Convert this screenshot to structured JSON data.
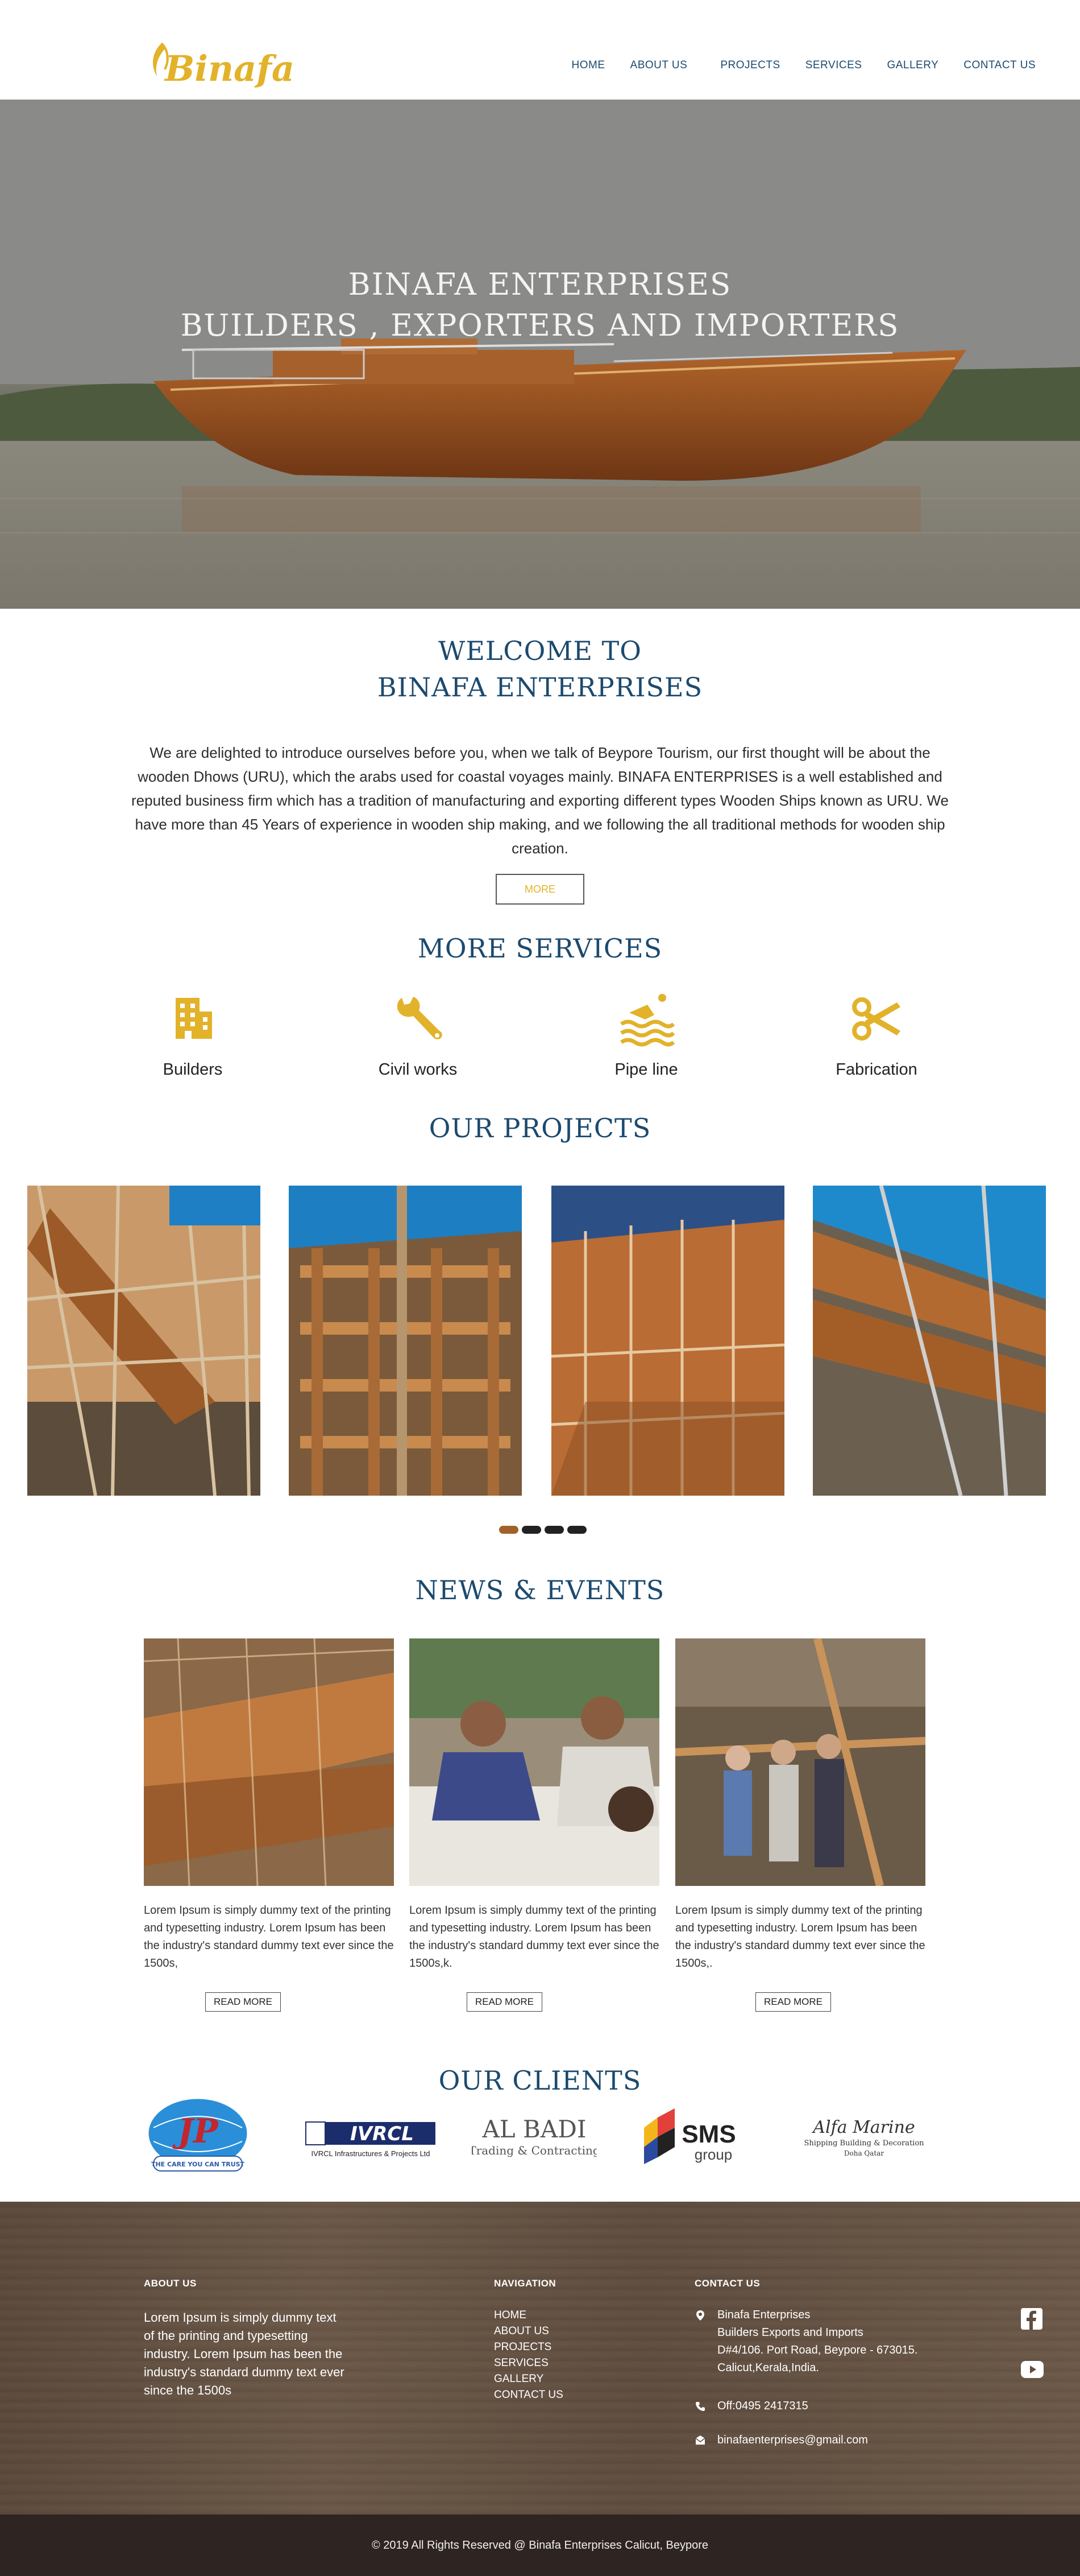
{
  "brand": {
    "logo_text": "Binafa",
    "accent_color": "#e2b22a",
    "heading_color": "#1c4a6e"
  },
  "nav": {
    "items": [
      "HOME",
      "ABOUT US",
      "PROJECTS",
      "SERVICES",
      "GALLERY",
      "CONTACT US"
    ]
  },
  "hero": {
    "line1": "BINAFA ENTERPRISES",
    "line2": "BUILDERS , EXPORTERS AND IMPORTERS"
  },
  "welcome": {
    "title_line1": "WELCOME TO",
    "title_line2": "BINAFA ENTERPRISES",
    "text": "We are delighted to introduce ourselves before you, when we talk of Beypore Tourism, our first thought will be about the wooden Dhows (URU), which the arabs used for coastal voyages mainly. BINAFA ENTERPRISES is a well established and reputed business firm which has a tradition of manufacturing and exporting different types Wooden Ships known as URU. We have more than 45 Years of experience in wooden ship making, and we following the all traditional methods for wooden ship creation.",
    "more_label": "MORE"
  },
  "services": {
    "title": "MORE SERVICES",
    "items": [
      {
        "label": "Builders",
        "icon": "building-icon"
      },
      {
        "label": "Civil works",
        "icon": "wrench-icon"
      },
      {
        "label": "Pipe line",
        "icon": "swimmer-waves-icon"
      },
      {
        "label": "Fabrication",
        "icon": "scissors-icon"
      }
    ]
  },
  "projects": {
    "title": "OUR PROJECTS",
    "slide_count": 4,
    "active_slide": 1
  },
  "news": {
    "title": "NEWS & EVENTS",
    "items": [
      {
        "text": "Lorem Ipsum is simply dummy text of the printing and typesetting industry. Lorem Ipsum has been the industry's standard dummy text ever since the 1500s,",
        "button": "READ MORE"
      },
      {
        "text": "Lorem Ipsum is simply dummy text of the printing and typesetting industry. Lorem Ipsum has been the industry's standard dummy text ever since the 1500s,k.",
        "button": "READ MORE"
      },
      {
        "text": "Lorem Ipsum is simply dummy text of the printing and typesetting industry. Lorem Ipsum has been the industry's standard dummy text ever since the 1500s,.",
        "button": "READ MORE"
      }
    ]
  },
  "clients": {
    "title": "OUR CLIENTS",
    "logos": {
      "jp_tagline": "THE CARE YOU CAN TRUST",
      "ivrcl_name": "IVRCL",
      "ivrcl_sub": "IVRCL Infrastructures & Projects Ltd",
      "albadi_name": "AL BADI",
      "albadi_sub": "Trading & Contracting",
      "sms_name": "SMS",
      "sms_sub": "group",
      "alfa_name": "Alfa Marine",
      "alfa_sub": "Shipping Building & Decoration",
      "alfa_sub2": "Doha Qatar"
    }
  },
  "footer": {
    "about_heading": "ABOUT US",
    "about_text": "Lorem Ipsum is simply dummy text of the printing and typesetting industry. Lorem Ipsum has been the industry's standard dummy text ever since the 1500s",
    "nav_heading": "NAVIGATION",
    "nav_items": [
      "HOME",
      "ABOUT US",
      "PROJECTS",
      "SERVICES",
      "GALLERY",
      "CONTACT US"
    ],
    "contact_heading": "CONTACT US",
    "address_line1": "Binafa Enterprises",
    "address_line2": "Builders Exports and Imports",
    "address_line3": "D#4/106. Port Road, Beypore - 673015.",
    "address_line4": "Calicut,Kerala,India.",
    "phone": "Off:0495 2417315",
    "email": "binafaenterprises@gmail.com",
    "copyright": "© 2019 All Rights Reserved @ Binafa Enterprises Calicut, Beypore"
  }
}
